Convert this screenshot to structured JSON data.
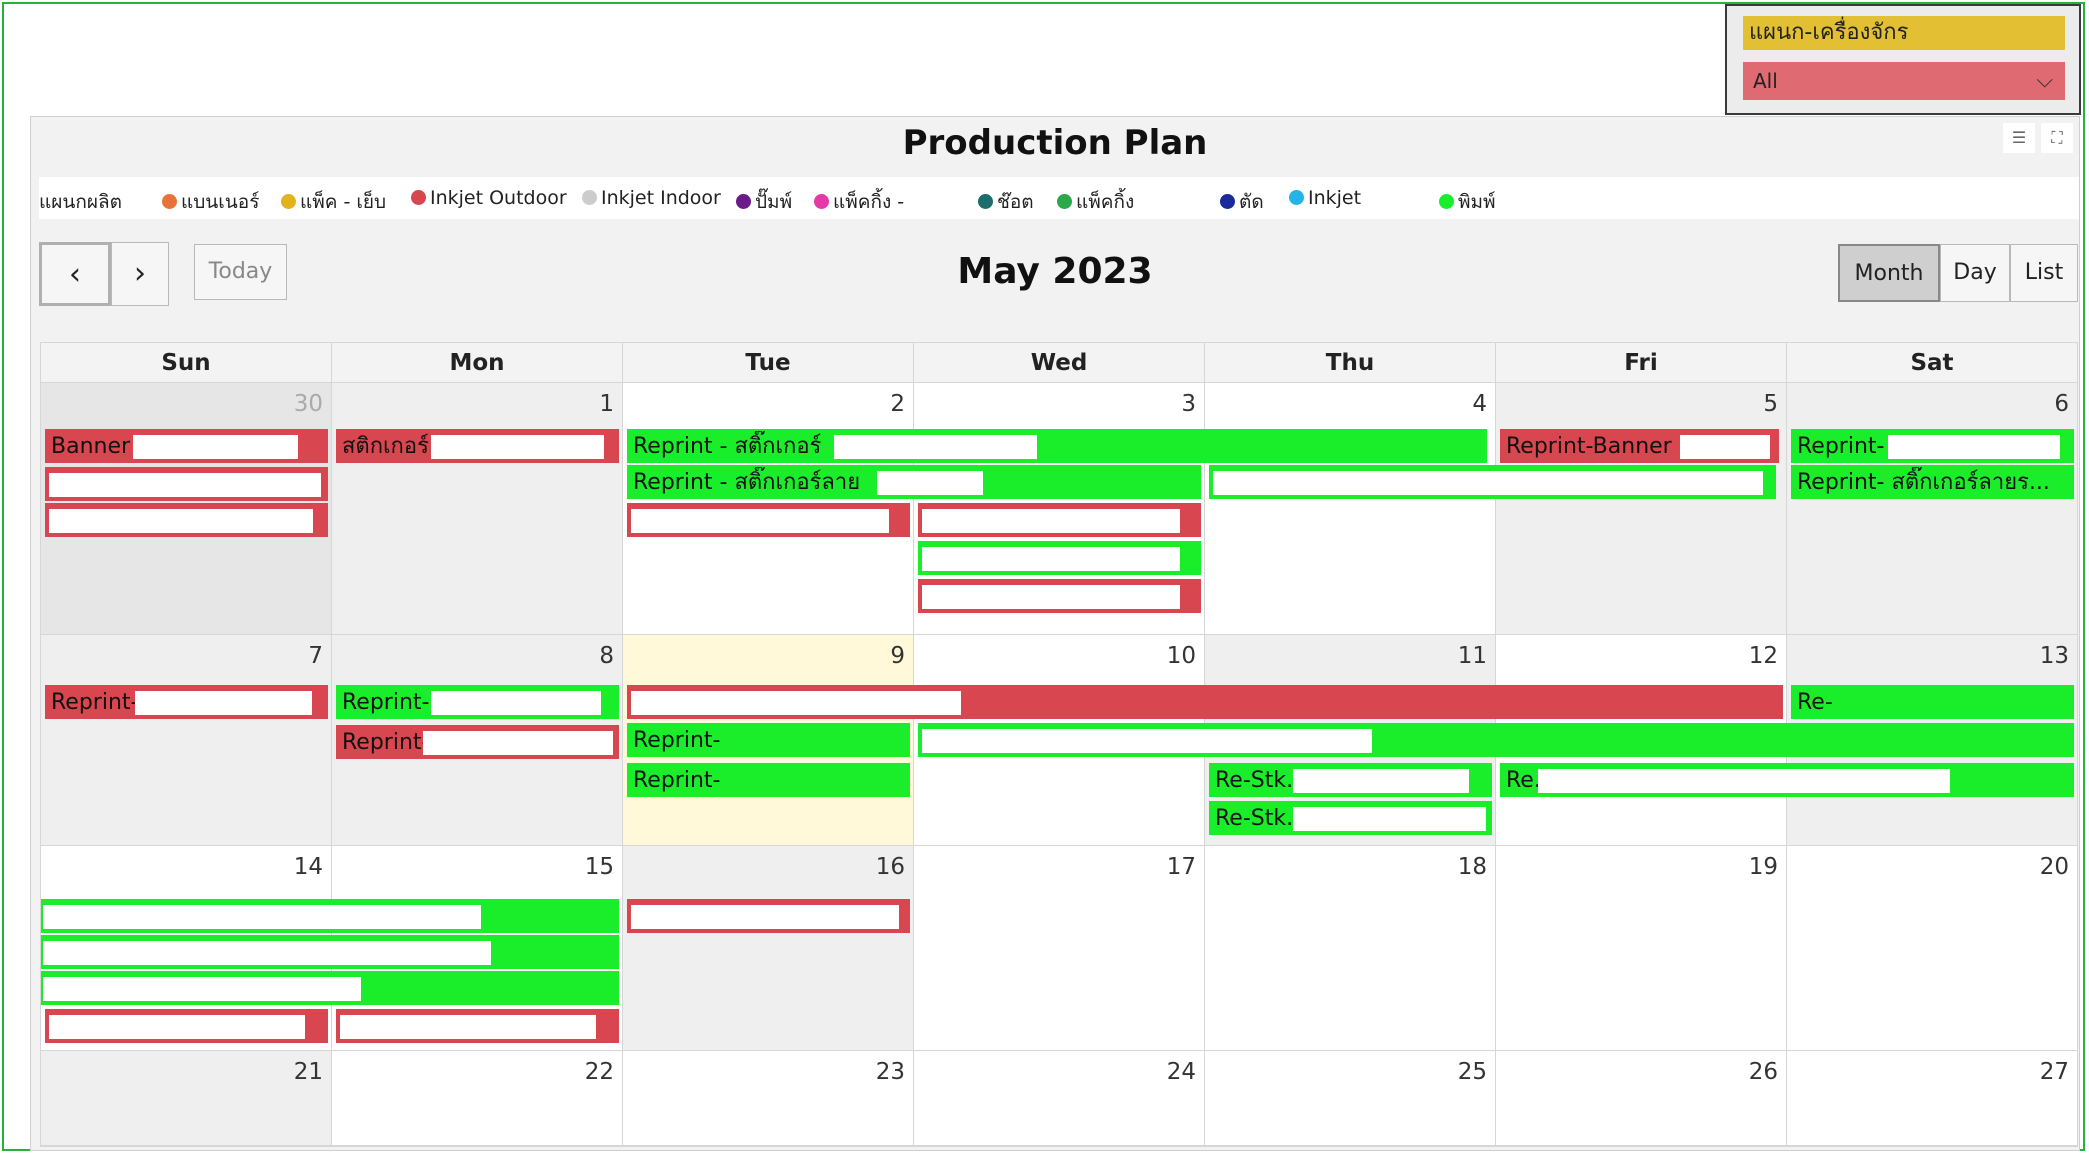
{
  "slicer": {
    "title": "แผนก-เครื่องจักร",
    "value": "All",
    "colors": {
      "title_bg": "#e3bf33",
      "dropdown_bg": "#e06a72"
    }
  },
  "visual": {
    "title": "Production Plan",
    "legend": {
      "label": "แผนกผลิต",
      "items": [
        {
          "name": "แบนเนอร์",
          "color": "#e8733a"
        },
        {
          "name": "แพ็ค - เย็บ",
          "color": "#e3b21d"
        },
        {
          "name": "Inkjet Outdoor",
          "color": "#d8464f"
        },
        {
          "name": "Inkjet Indoor",
          "color": "#cccccc"
        },
        {
          "name": "ปั๊มพ์",
          "color": "#6b1a8a"
        },
        {
          "name": "แพ็คกิ้ง -",
          "color": "#e43aa8"
        },
        {
          "name": "ช๊อต",
          "color": "#1d6e6a"
        },
        {
          "name": "แพ็คกิ้ง",
          "color": "#2aa84a"
        },
        {
          "name": "ตัด",
          "color": "#1a2a9a"
        },
        {
          "name": "Inkjet",
          "color": "#23b4e8"
        },
        {
          "name": "พิมพ์",
          "color": "#1aee2a"
        }
      ]
    }
  },
  "calendar": {
    "title": "May 2023",
    "toolbar": {
      "prev": "‹",
      "next": "›",
      "today": "Today",
      "views": [
        "Month",
        "Day",
        "List"
      ],
      "active_view": "Month"
    },
    "weekdays": [
      "Sun",
      "Mon",
      "Tue",
      "Wed",
      "Thu",
      "Fri",
      "Sat"
    ],
    "weeks": [
      [
        "30",
        "1",
        "2",
        "3",
        "4",
        "5",
        "6"
      ],
      [
        "7",
        "8",
        "9",
        "10",
        "11",
        "12",
        "13"
      ],
      [
        "14",
        "15",
        "16",
        "17",
        "18",
        "19",
        "20"
      ],
      [
        "21",
        "22",
        "23",
        "24",
        "25",
        "26",
        "27"
      ]
    ],
    "today": "9",
    "events": [
      {
        "label": "Banner"
      },
      {
        "label": "สติกเกอร์"
      },
      {
        "label": "Reprint - สติ๊กเกอร์"
      },
      {
        "label": "Reprint-Banner"
      },
      {
        "label": "Reprint-"
      },
      {
        "label": "Reprint - สติ๊กเกอร์ลาย"
      },
      {
        "label": "Reprint- สติ๊กเกอร์ลายร..."
      },
      {
        "label": "Reprint-"
      },
      {
        "label": "Reprint-"
      },
      {
        "label": "Reprint-"
      },
      {
        "label": "Re-"
      },
      {
        "label": "Reprint-"
      },
      {
        "label": "Reprint-"
      },
      {
        "label": "Re-Stk."
      },
      {
        "label": "Re."
      },
      {
        "label": "Re-Stk."
      }
    ],
    "colors": {
      "inkjet_outdoor": "#d8464f",
      "print": "#1aee2a",
      "today_bg": "#fff9d9",
      "other_month_bg": "#e6e6e6"
    }
  }
}
